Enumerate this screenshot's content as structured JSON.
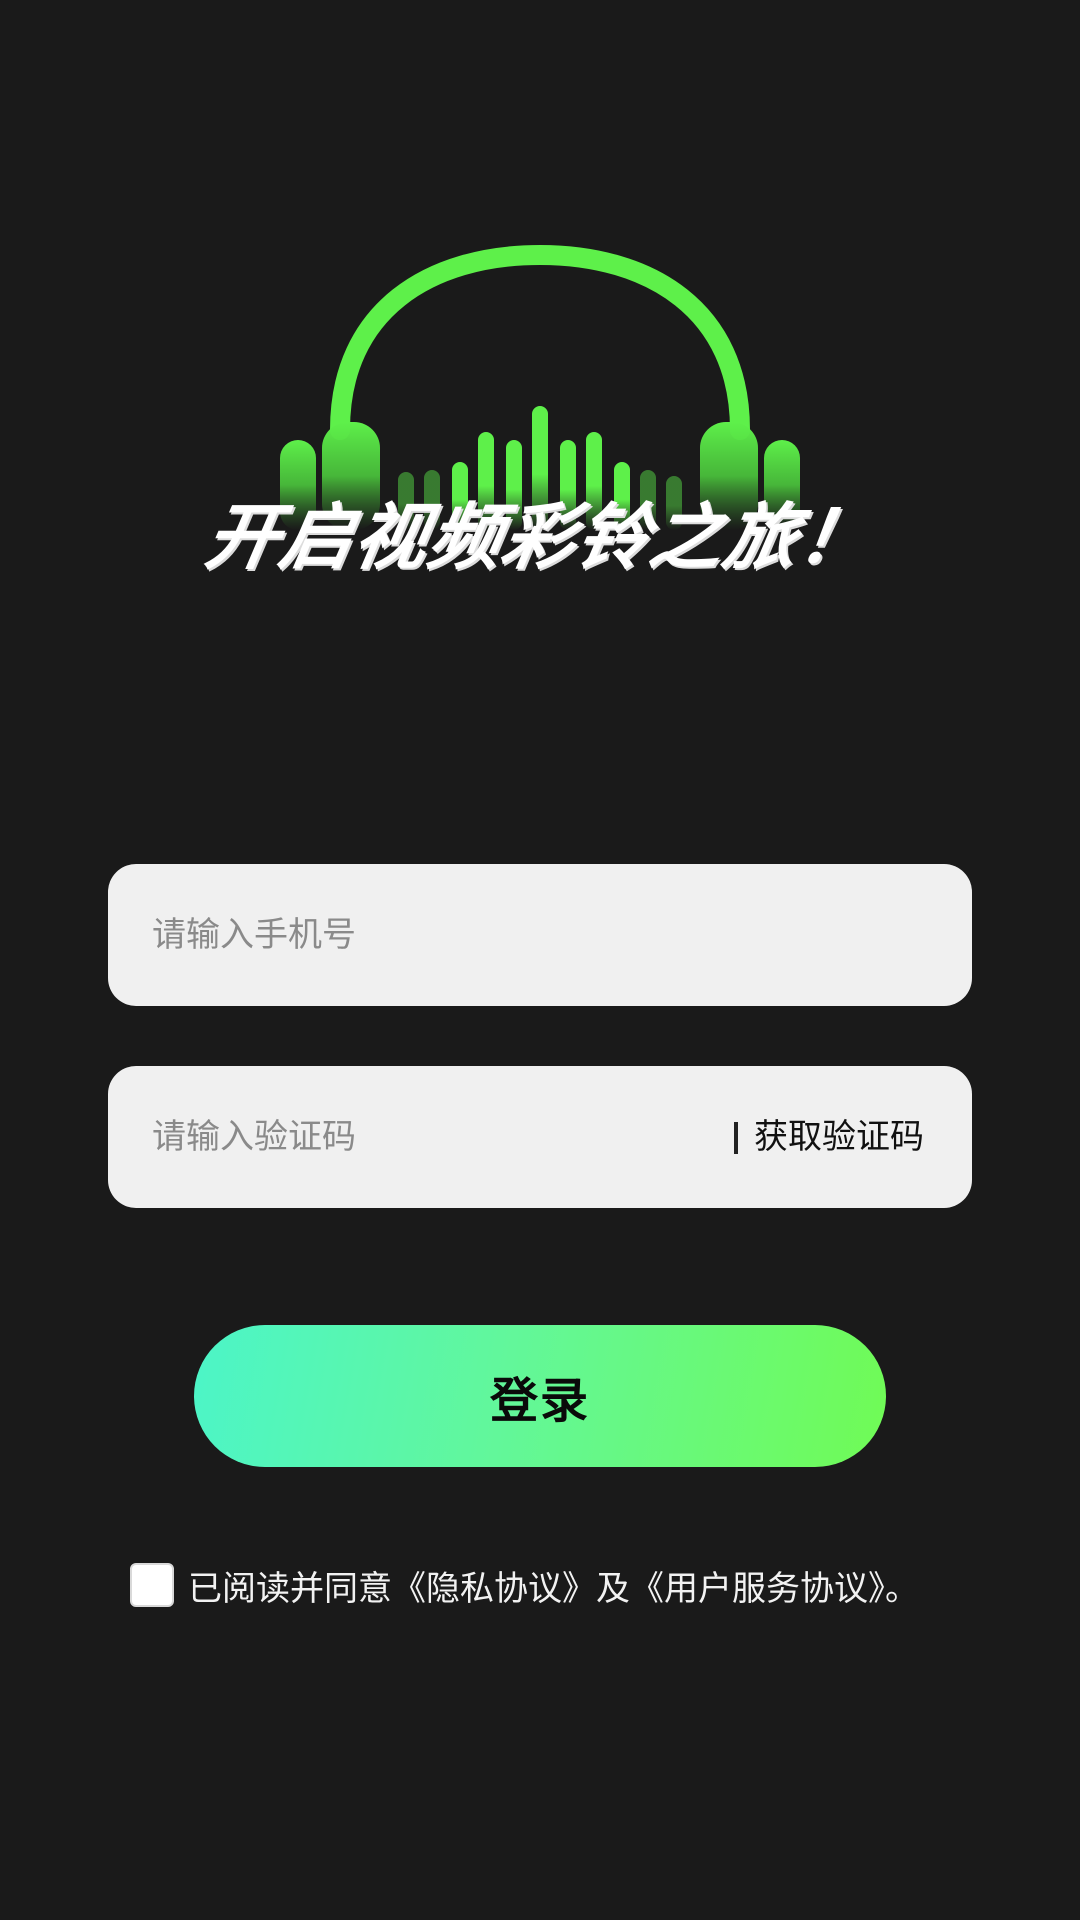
{
  "hero": {
    "slogan": "开启视频彩铃之旅！",
    "icon": "headphones-equalizer-icon",
    "accent_color": "#5ef04a"
  },
  "form": {
    "phone_placeholder": "请输入手机号",
    "phone_value": "",
    "code_placeholder": "请输入验证码",
    "code_value": "",
    "get_code_label": "获取验证码"
  },
  "login": {
    "label": "登录",
    "gradient_start": "#4cf5c8",
    "gradient_end": "#70fb55"
  },
  "agreement": {
    "checked": false,
    "prefix": "已阅读并同意",
    "privacy_link": "《隐私协议》",
    "joiner": "及",
    "service_link": "《用户服务协议》",
    "suffix": "。"
  },
  "colors": {
    "background": "#1a1a1a",
    "input_bg": "#f0f0f0"
  }
}
